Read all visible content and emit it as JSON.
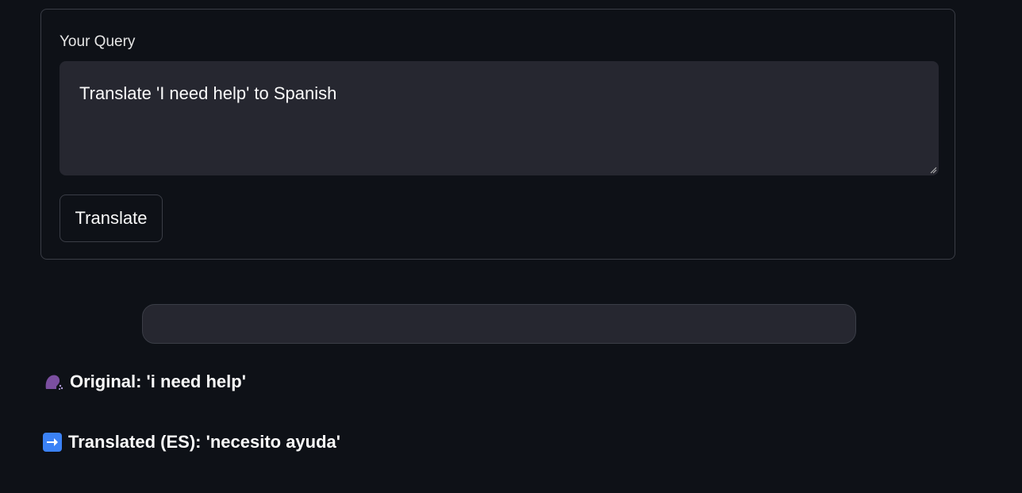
{
  "form": {
    "label": "Your Query",
    "query_value": "Translate 'I need help' to Spanish",
    "button_label": "Translate"
  },
  "results": {
    "original_text": "Original: 'i need help'",
    "translated_text": "Translated (ES): 'necesito ayuda'"
  },
  "icons": {
    "original": "speaking-head-icon",
    "translated": "right-arrow-icon"
  },
  "colors": {
    "background": "#0e1117",
    "input_bg": "#262730",
    "border": "#3a3d46",
    "arrow_bg": "#3b82f6",
    "speaker_color": "#7b4fa0"
  }
}
